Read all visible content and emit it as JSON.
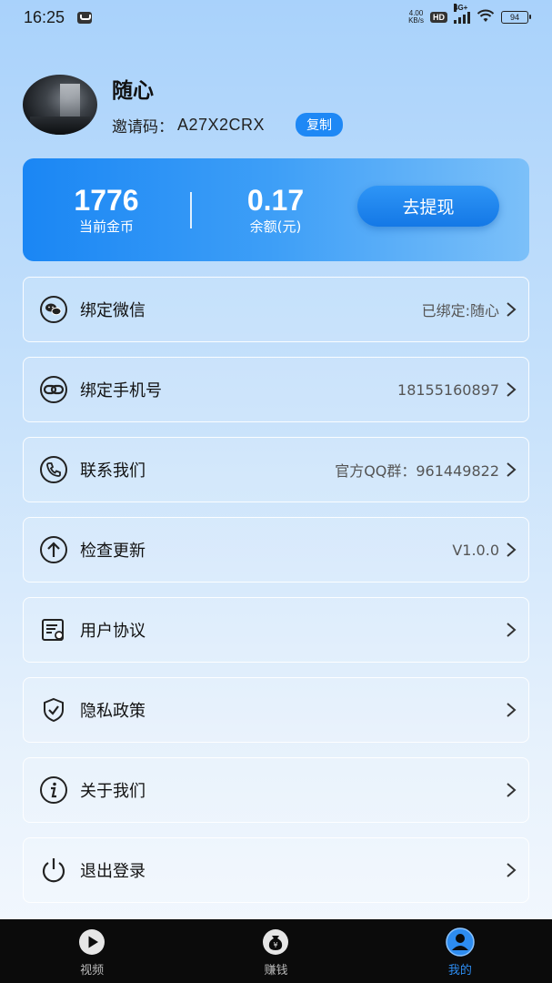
{
  "status_bar": {
    "time": "16:25",
    "net_speed_value": "4.00",
    "net_speed_unit": "KB/s",
    "hd": "HD",
    "network": "4G+",
    "battery": "94"
  },
  "profile": {
    "name": "随心",
    "invite_label": "邀请码：",
    "invite_code": "A27X2CRX",
    "copy_label": "复制"
  },
  "wallet": {
    "coins_value": "1776",
    "coins_label": "当前金币",
    "balance_value": "0.17",
    "balance_label": "余额(元)",
    "withdraw_label": "去提现"
  },
  "menu": [
    {
      "label": "绑定微信",
      "value": "已绑定:随心",
      "icon": "wechat-icon"
    },
    {
      "label": "绑定手机号",
      "value": "18155160897",
      "icon": "link-icon"
    },
    {
      "label": "联系我们",
      "value": "官方QQ群：961449822",
      "icon": "phone-icon"
    },
    {
      "label": "检查更新",
      "value": "V1.0.0",
      "icon": "arrow-up-icon"
    },
    {
      "label": "用户协议",
      "value": "",
      "icon": "document-icon"
    },
    {
      "label": "隐私政策",
      "value": "",
      "icon": "shield-icon"
    },
    {
      "label": "关于我们",
      "value": "",
      "icon": "info-icon"
    },
    {
      "label": "退出登录",
      "value": "",
      "icon": "power-icon"
    }
  ],
  "bottom_nav": [
    {
      "label": "视频",
      "icon": "play-icon",
      "active": false
    },
    {
      "label": "赚钱",
      "icon": "money-bag-icon",
      "active": false
    },
    {
      "label": "我的",
      "icon": "user-icon",
      "active": true
    }
  ],
  "colors": {
    "accent": "#1e88f5",
    "nav_active": "#2d8cf0",
    "nav_bg": "#0b0b0b"
  }
}
